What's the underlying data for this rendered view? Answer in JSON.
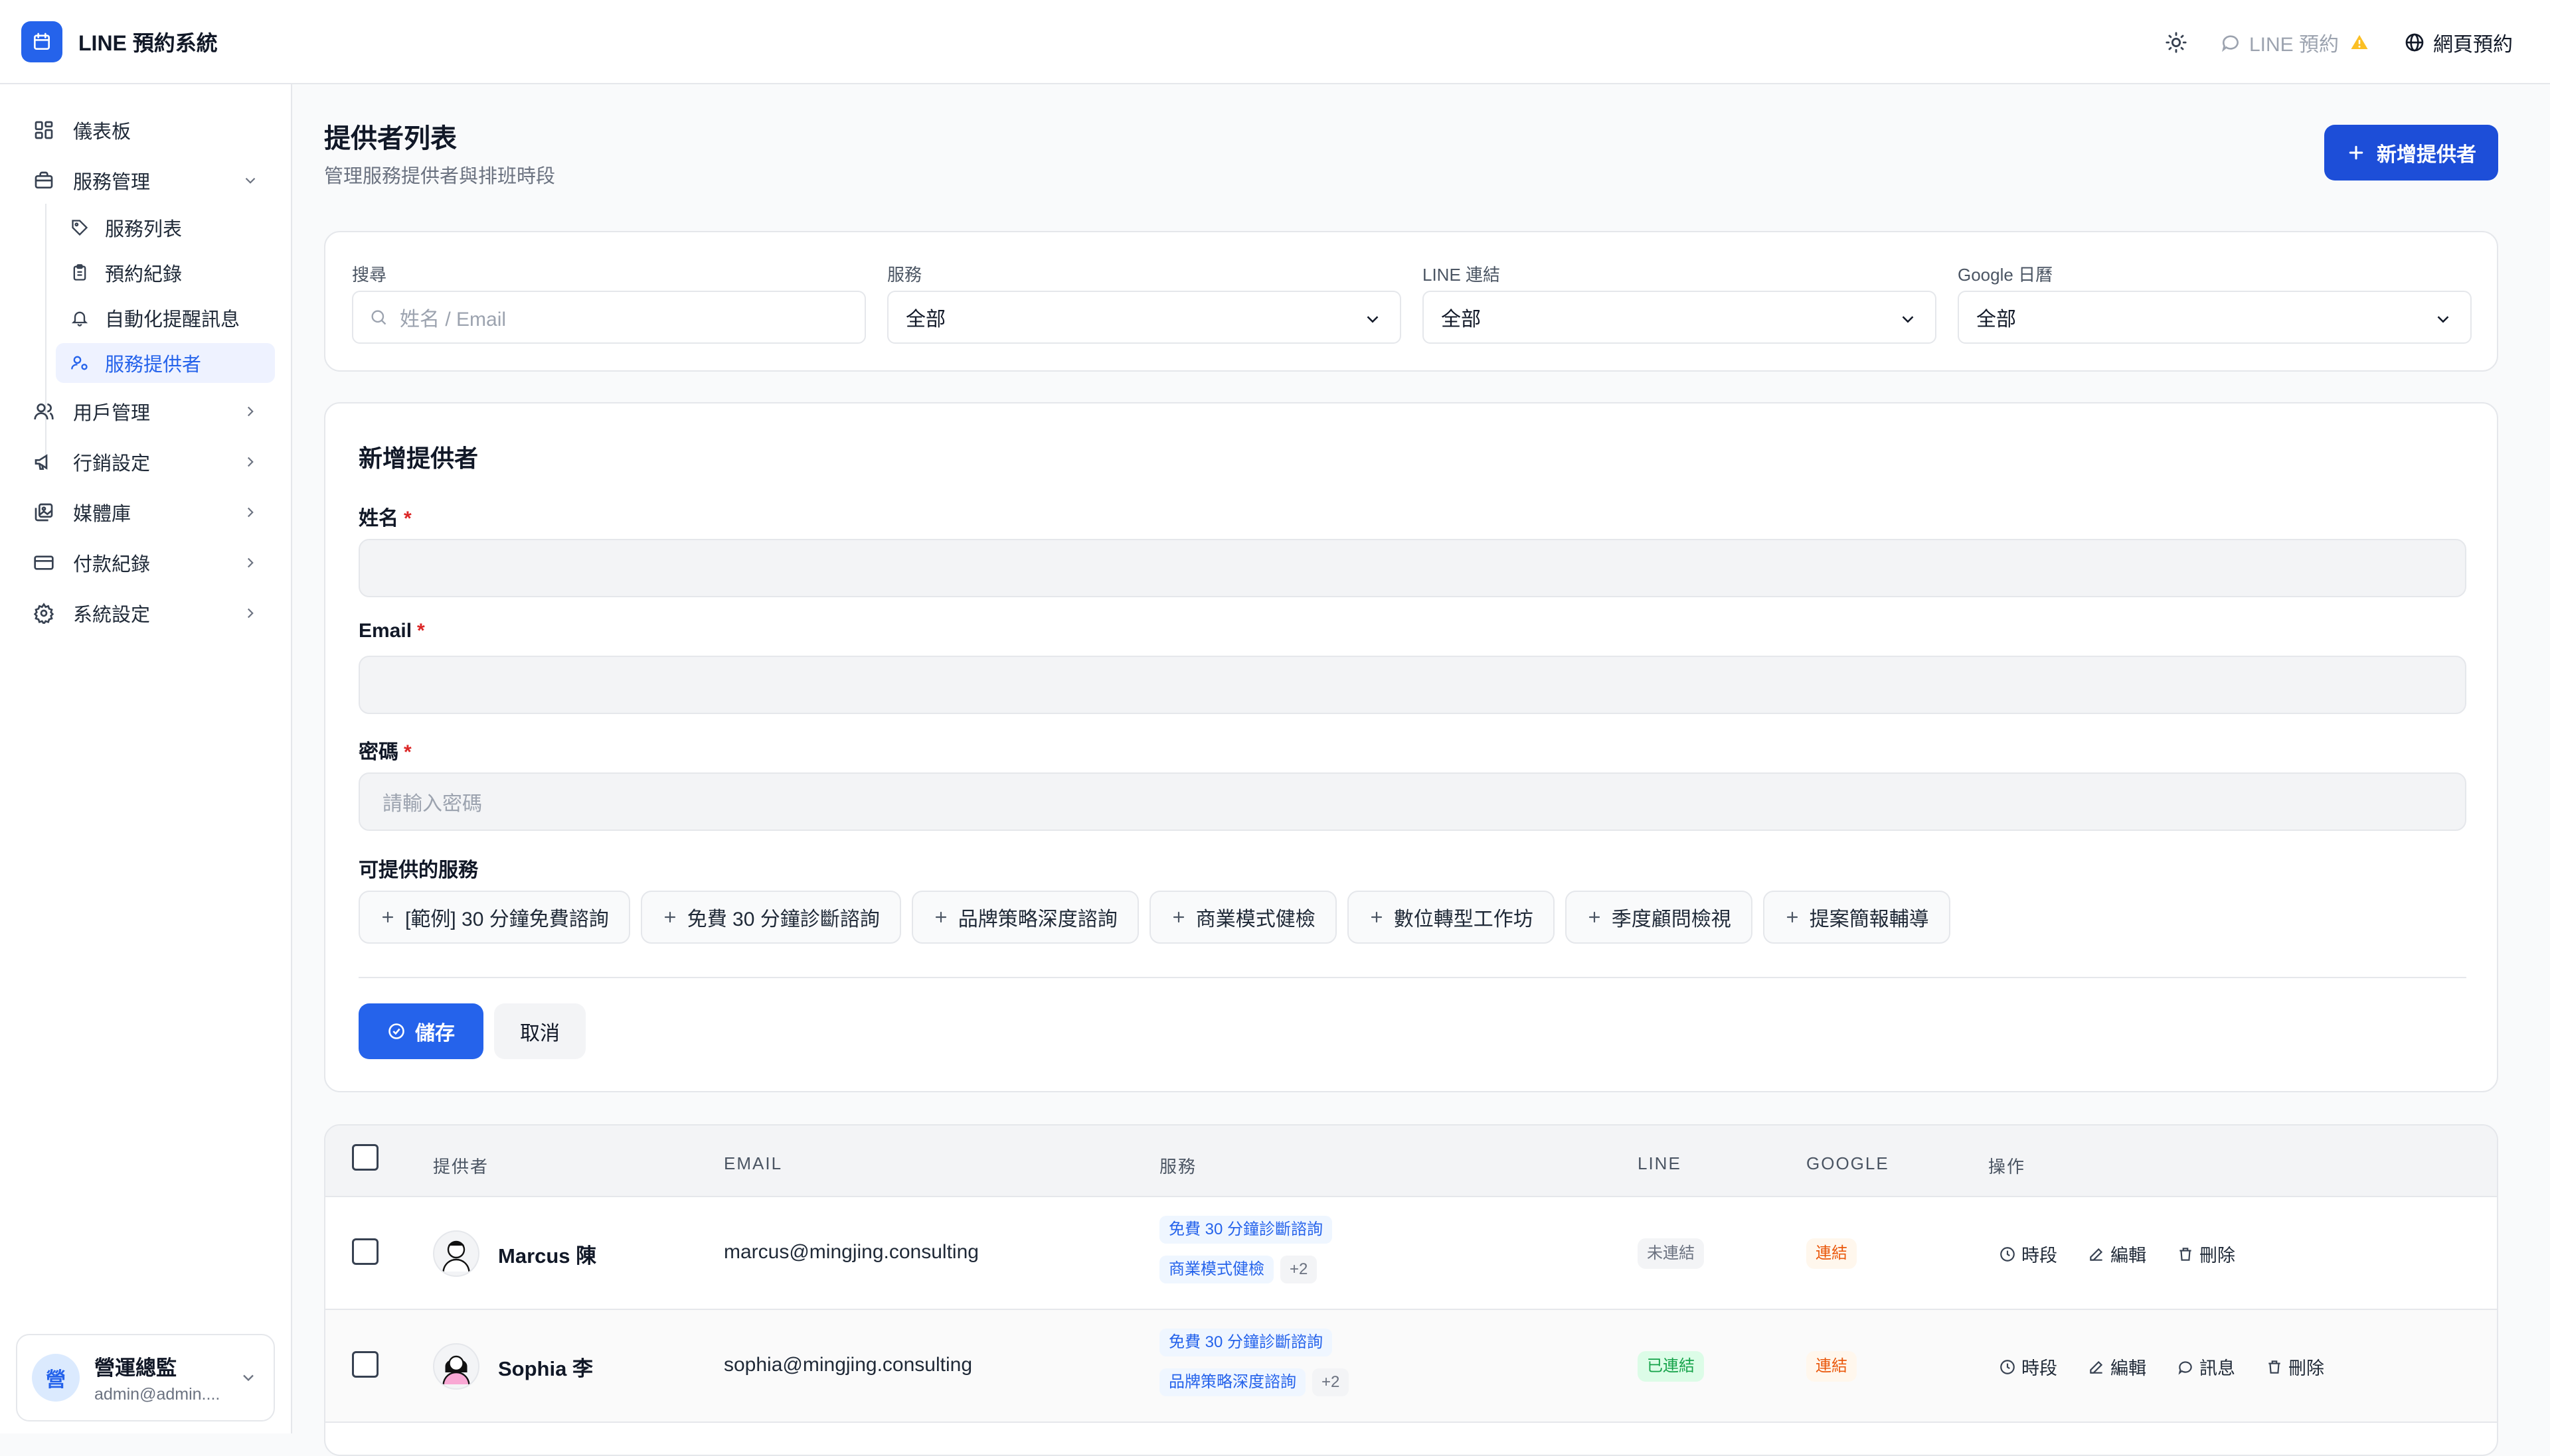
{
  "app": {
    "title": "LINE 預約系統"
  },
  "topbar": {
    "line_label": "LINE 預約",
    "web_label": "網頁預約"
  },
  "sidebar": {
    "dashboard": "儀表板",
    "service_mgmt": "服務管理",
    "sub": {
      "service_list": "服務列表",
      "booking_records": "預約紀錄",
      "auto_reminder": "自動化提醒訊息",
      "providers": "服務提供者"
    },
    "user_mgmt": "用戶管理",
    "marketing": "行銷設定",
    "media": "媒體庫",
    "payments": "付款紀錄",
    "settings": "系統設定",
    "user": {
      "avatar": "營",
      "name": "營運總監",
      "email": "admin@admin...."
    }
  },
  "page": {
    "title": "提供者列表",
    "subtitle": "管理服務提供者與排班時段",
    "add_button": "新增提供者"
  },
  "filters": {
    "search": {
      "label": "搜尋",
      "placeholder": "姓名 / Email"
    },
    "service": {
      "label": "服務",
      "value": "全部"
    },
    "line": {
      "label": "LINE 連結",
      "value": "全部"
    },
    "google": {
      "label": "Google 日曆",
      "value": "全部"
    }
  },
  "form": {
    "title": "新增提供者",
    "name_label": "姓名",
    "email_label": "Email",
    "password_label": "密碼",
    "password_placeholder": "請輸入密碼",
    "required_mark": "*",
    "services_label": "可提供的服務",
    "services": [
      "[範例] 30 分鐘免費諮詢",
      "免費 30 分鐘診斷諮詢",
      "品牌策略深度諮詢",
      "商業模式健檢",
      "數位轉型工作坊",
      "季度顧問檢視",
      "提案簡報輔導"
    ],
    "save": "儲存",
    "cancel": "取消"
  },
  "table": {
    "headers": {
      "provider": "提供者",
      "email": "EMAIL",
      "services": "服務",
      "line": "LINE",
      "google": "GOOGLE",
      "actions": "操作"
    },
    "rows": [
      {
        "name": "Marcus 陳",
        "email": "marcus@mingjing.consulting",
        "services": [
          "免費 30 分鐘診斷諮詢",
          "商業模式健檢"
        ],
        "more": "+2",
        "line_status": "未連結",
        "google_status": "連結",
        "actions": {
          "slots": "時段",
          "edit": "編輯",
          "delete": "刪除"
        }
      },
      {
        "name": "Sophia 李",
        "email": "sophia@mingjing.consulting",
        "services": [
          "免費 30 分鐘診斷諮詢",
          "品牌策略深度諮詢"
        ],
        "more": "+2",
        "line_status": "已連結",
        "google_status": "連結",
        "actions": {
          "slots": "時段",
          "edit": "編輯",
          "message": "訊息",
          "delete": "刪除"
        }
      }
    ]
  },
  "colors": {
    "primary": "#2563eb",
    "danger": "#dc2626",
    "success": "#16a34a",
    "warning": "#ea580c"
  }
}
